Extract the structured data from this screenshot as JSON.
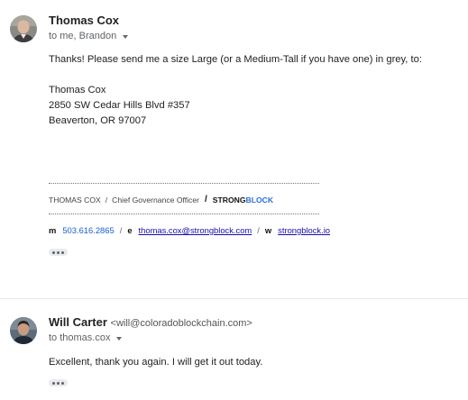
{
  "messages": [
    {
      "sender_name": "Thomas Cox",
      "recipients": "to me, Brandon",
      "body_lines": [
        "Thanks! Please send me a size Large (or a Medium-Tall if you have one) in grey, to:",
        "Thomas Cox",
        "2850 SW Cedar Hills Blvd #357",
        "Beaverton, OR 97007"
      ],
      "signature": {
        "name": "THOMAS COX",
        "sep": "/",
        "title": "Chief Governance Officer",
        "brand_part1": "STRONG",
        "brand_part2": "BLOCK",
        "mobile_label": "m",
        "mobile": "503.616.2865",
        "email_label": "e",
        "email": "thomas.cox@strongblock.com",
        "web_label": "w",
        "web": "strongblock.io"
      }
    },
    {
      "sender_name": "Will Carter",
      "sender_email": "<will@coloradoblockchain.com>",
      "recipients": "to thomas.cox",
      "body_lines": [
        "Excellent, thank you again. I will get it out today."
      ]
    }
  ],
  "colors": {
    "brand_accent": "#2b6fd6",
    "link": "#1a0dab",
    "muted_text": "#5f6368"
  },
  "icons": {
    "avatar": "person-photo",
    "recipient_toggle": "caret-down-icon",
    "show_trimmed": "ellipsis-icon"
  }
}
